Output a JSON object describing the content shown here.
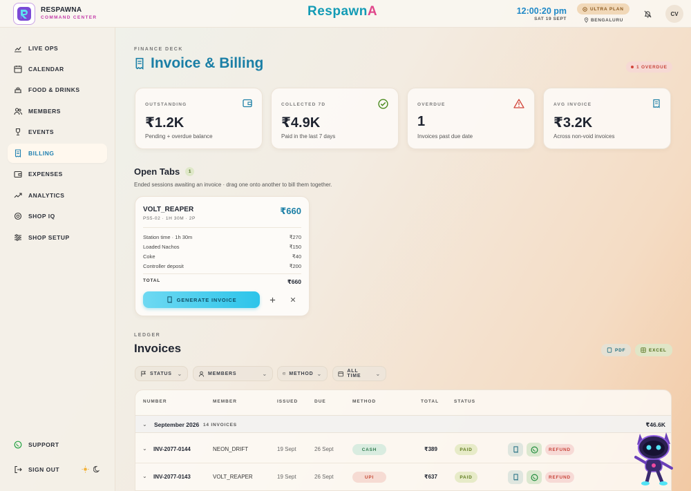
{
  "brand": {
    "name": "RESPAWNA",
    "subtitle": "COMMAND CENTER",
    "wordmark_main": "Respawn",
    "wordmark_tail": "A"
  },
  "header": {
    "time": "12:00:20 pm",
    "date": "SAT 19 SEPT",
    "plan": "ULTRA PLAN",
    "location": "BENGALURU",
    "avatar_initials": "CV"
  },
  "sidebar": {
    "items": [
      {
        "label": "LIVE OPS",
        "icon": "chart-line-icon"
      },
      {
        "label": "CALENDAR",
        "icon": "calendar-icon"
      },
      {
        "label": "FOOD & DRINKS",
        "icon": "food-icon"
      },
      {
        "label": "MEMBERS",
        "icon": "members-icon"
      },
      {
        "label": "EVENTS",
        "icon": "trophy-icon"
      },
      {
        "label": "BILLING",
        "icon": "receipt-icon",
        "active": true
      },
      {
        "label": "EXPENSES",
        "icon": "wallet-icon"
      },
      {
        "label": "ANALYTICS",
        "icon": "trend-icon"
      },
      {
        "label": "SHOP IQ",
        "icon": "brain-icon"
      },
      {
        "label": "SHOP SETUP",
        "icon": "sliders-icon"
      }
    ],
    "support": "SUPPORT",
    "sign_out": "SIGN OUT"
  },
  "page": {
    "eyebrow": "FINANCE DECK",
    "title": "Invoice & Billing",
    "overdue_badge": "1 OVERDUE"
  },
  "stats": [
    {
      "label": "OUTSTANDING",
      "value": "₹1.2K",
      "sub": "Pending + overdue balance",
      "icon": "wallet-icon"
    },
    {
      "label": "COLLECTED 7D",
      "value": "₹4.9K",
      "sub": "Paid in the last 7 days",
      "icon": "check-circle-icon"
    },
    {
      "label": "OVERDUE",
      "value": "1",
      "sub": "Invoices past due date",
      "icon": "warning-icon"
    },
    {
      "label": "AVG INVOICE",
      "value": "₹3.2K",
      "sub": "Across non-void invoices",
      "icon": "receipt-icon"
    }
  ],
  "open_tabs": {
    "title": "Open Tabs",
    "count": "1",
    "subtitle": "Ended sessions awaiting an invoice · drag one onto another to bill them together.",
    "card": {
      "player": "VOLT_REAPER",
      "meta": "PS5-02 · 1H 30M · 2P",
      "amount": "₹660",
      "items": [
        {
          "name": "Station time · 1h 30m",
          "price": "₹270"
        },
        {
          "name": "Loaded Nachos",
          "price": "₹150"
        },
        {
          "name": "Coke",
          "price": "₹40"
        },
        {
          "name": "Controller deposit",
          "price": "₹200"
        }
      ],
      "total_label": "TOTAL",
      "total_value": "₹660",
      "generate_label": "GENERATE INVOICE"
    }
  },
  "ledger": {
    "eyebrow": "LEDGER",
    "title": "Invoices",
    "pdf": "PDF",
    "excel": "EXCEL",
    "filters": [
      "STATUS",
      "MEMBERS",
      "METHOD",
      "ALL TIME"
    ],
    "columns": [
      "NUMBER",
      "MEMBER",
      "ISSUED",
      "DUE",
      "METHOD",
      "TOTAL",
      "STATUS"
    ],
    "group": {
      "name": "September 2026",
      "count": "14 INVOICES",
      "sum": "₹46.6K"
    },
    "rows": [
      {
        "number": "INV-2077-0144",
        "member": "NEON_DRIFT",
        "issued": "19 Sept",
        "due": "26 Sept",
        "method": "CASH",
        "total": "₹389",
        "status": "PAID",
        "refund": "REFUND"
      },
      {
        "number": "INV-2077-0143",
        "member": "VOLT_REAPER",
        "issued": "19 Sept",
        "due": "26 Sept",
        "method": "UPI",
        "total": "₹637",
        "status": "PAID",
        "refund": "REFUND"
      }
    ]
  },
  "colors": {
    "accent": "#1b7fa6",
    "brand_pink": "#c23aa8",
    "paid": "#5d7a1c",
    "danger": "#c8433a"
  }
}
